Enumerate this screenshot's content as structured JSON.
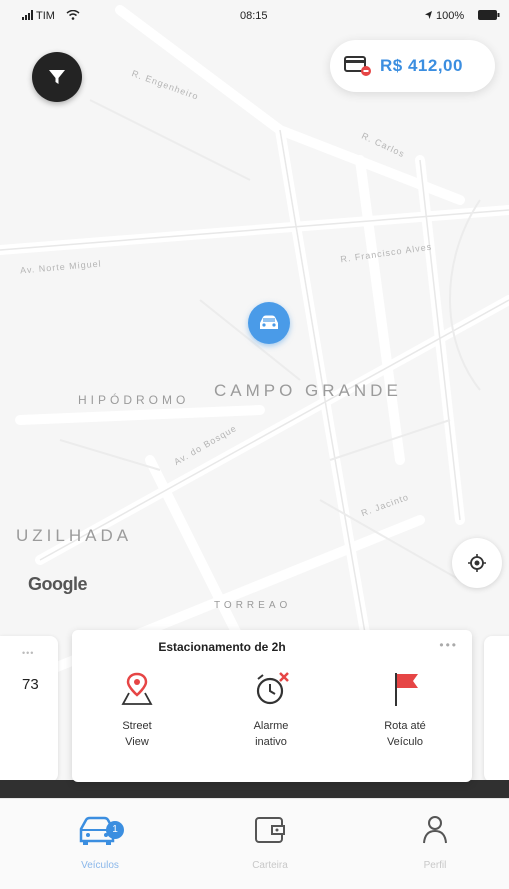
{
  "status_bar": {
    "carrier": "TIM",
    "time": "08:15",
    "battery": "100%"
  },
  "balance": {
    "amount": "R$ 412,00"
  },
  "map": {
    "neighborhoods": [
      "HIPÓDROMO",
      "CAMPO GRANDE",
      "UZILHADA",
      "TORREAO"
    ],
    "attribution": "Google"
  },
  "parking_card": {
    "title": "Estacionamento de 2h",
    "actions": [
      {
        "label_line1": "Street",
        "label_line2": "View",
        "icon": "map-pin-icon"
      },
      {
        "label_line1": "Alarme",
        "label_line2": "inativo",
        "icon": "alarm-off-icon"
      },
      {
        "label_line1": "Rota até",
        "label_line2": "Veículo",
        "icon": "flag-icon"
      }
    ]
  },
  "side_card_left": {
    "value": "73"
  },
  "bottom_nav": {
    "items": [
      {
        "label": "Veículos",
        "icon": "car-icon",
        "active": true,
        "badge": "1"
      },
      {
        "label": "Carteira",
        "icon": "wallet-icon",
        "active": false
      },
      {
        "label": "Perfil",
        "icon": "user-icon",
        "active": false
      }
    ]
  },
  "colors": {
    "accent": "#3b8ee0",
    "marker": "#4a9be8",
    "alert": "#e64545",
    "dark_button": "#232323"
  }
}
